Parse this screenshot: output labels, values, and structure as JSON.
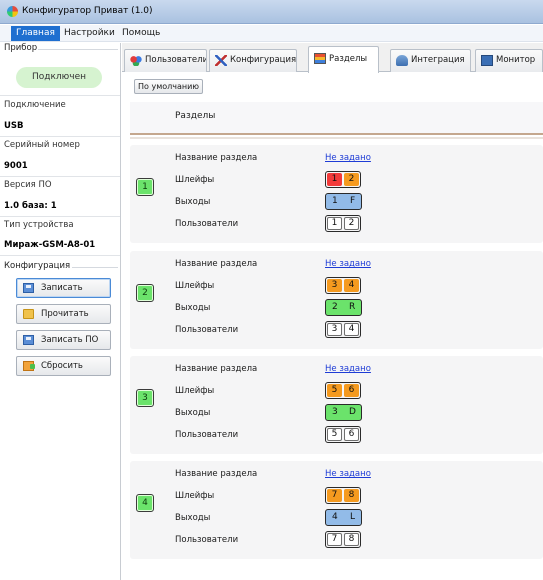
{
  "window": {
    "title": "Конфигуратор Приват (1.0)"
  },
  "menu": {
    "items": [
      "Главная",
      "Настройки",
      "Помощь"
    ]
  },
  "sidebar": {
    "device_group": "Прибор",
    "status": "Подключен",
    "connection_label": "Подключение",
    "connection_value": "USB",
    "serial_label": "Серийный номер",
    "serial_value": "9001",
    "firmware_label": "Версия ПО",
    "firmware_value": "1.0 база: 1",
    "device_type_label": "Тип устройства",
    "device_type_value": "Мираж-GSM-A8-01",
    "config_group": "Конфигурация",
    "buttons": [
      "Записать",
      "Прочитать",
      "Записать ПО",
      "Сбросить"
    ]
  },
  "tabs": [
    "Пользователи",
    "Конфигурация",
    "Разделы",
    "Интеграция",
    "Монитор"
  ],
  "active_tab": "Разделы",
  "toolbar": {
    "default_label": "По умолчанию"
  },
  "header": {
    "title": "Разделы"
  },
  "row_labels": {
    "name": "Название раздела",
    "loops": "Шлейфы",
    "outputs": "Выходы",
    "users": "Пользователи"
  },
  "sections": [
    {
      "number": "1",
      "name": "Не задано",
      "loops": [
        {
          "label": "1",
          "color": "#f23a3a"
        },
        {
          "label": "2",
          "color": "#f59a1f"
        }
      ],
      "outputs": {
        "a": "1",
        "b": "F",
        "color": "#92bbe8"
      },
      "users": [
        "1",
        "2"
      ]
    },
    {
      "number": "2",
      "name": "Не задано",
      "loops": [
        {
          "label": "3",
          "color": "#f59a1f"
        },
        {
          "label": "4",
          "color": "#f59a1f"
        }
      ],
      "outputs": {
        "a": "2",
        "b": "R",
        "color": "#6be36b"
      },
      "users": [
        "3",
        "4"
      ]
    },
    {
      "number": "3",
      "name": "Не задано",
      "loops": [
        {
          "label": "5",
          "color": "#f59a1f"
        },
        {
          "label": "6",
          "color": "#f59a1f"
        }
      ],
      "outputs": {
        "a": "3",
        "b": "D",
        "color": "#6be36b"
      },
      "users": [
        "5",
        "6"
      ]
    },
    {
      "number": "4",
      "name": "Не задано",
      "loops": [
        {
          "label": "7",
          "color": "#f59a1f"
        },
        {
          "label": "8",
          "color": "#f59a1f"
        }
      ],
      "outputs": {
        "a": "4",
        "b": "L",
        "color": "#92bbe8"
      },
      "users": [
        "7",
        "8"
      ]
    }
  ]
}
